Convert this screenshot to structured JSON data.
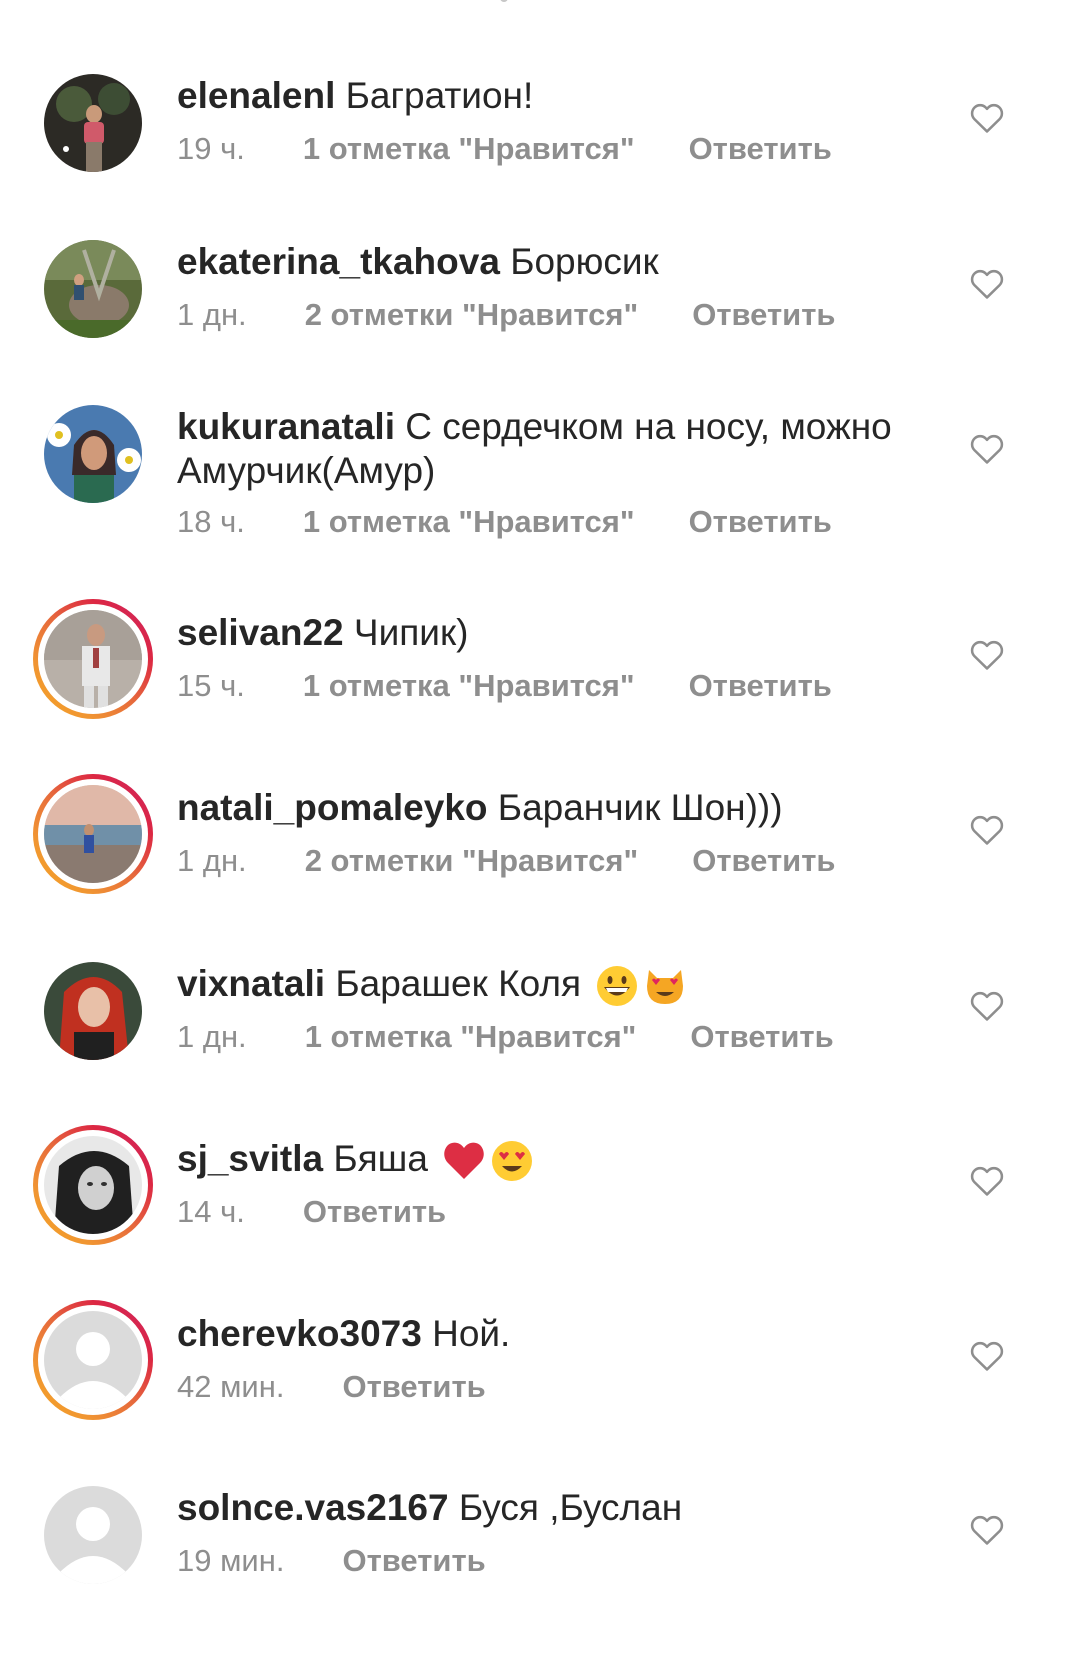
{
  "comments": [
    {
      "username": "elenalenl",
      "text": "Багратион!",
      "time": "19 ч.",
      "likes": "1 отметка \"Нравится\"",
      "reply": "Ответить",
      "story_ring": false,
      "avatar": "photo"
    },
    {
      "username": "ekaterina_tkahova",
      "text": "Борюсик",
      "time": "1 дн.",
      "likes": "2 отметки \"Нравится\"",
      "reply": "Ответить",
      "story_ring": false,
      "avatar": "photo"
    },
    {
      "username": "kukuranatali",
      "text": "С сердечком на носу, можно Амурчик(Амур)",
      "time": "18 ч.",
      "likes": "1 отметка \"Нравится\"",
      "reply": "Ответить",
      "story_ring": false,
      "avatar": "photo"
    },
    {
      "username": "selivan22",
      "text": "Чипик)",
      "time": "15 ч.",
      "likes": "1 отметка \"Нравится\"",
      "reply": "Ответить",
      "story_ring": true,
      "avatar": "photo"
    },
    {
      "username": "natali_pomaleyko",
      "text": "Баранчик Шон)))",
      "time": "1 дн.",
      "likes": "2 отметки \"Нравится\"",
      "reply": "Ответить",
      "story_ring": true,
      "avatar": "photo"
    },
    {
      "username": "vixnatali",
      "text": "Барашек Коля",
      "emojis": [
        "grinning-face-emoji",
        "heart-eyes-cat-emoji"
      ],
      "time": "1 дн.",
      "likes": "1 отметка \"Нравится\"",
      "reply": "Ответить",
      "story_ring": false,
      "avatar": "photo"
    },
    {
      "username": "sj_svitla",
      "text": "Бяша",
      "emojis": [
        "red-heart-emoji",
        "heart-eyes-emoji"
      ],
      "time": "14 ч.",
      "reply": "Ответить",
      "story_ring": true,
      "avatar": "photo"
    },
    {
      "username": "cherevko3073",
      "text": "Ной.",
      "time": "42 мин.",
      "reply": "Ответить",
      "story_ring": true,
      "avatar": "default-user-icon"
    },
    {
      "username": "solnce.vas2167",
      "text": "Буся ,Буслан",
      "time": "19 мин.",
      "reply": "Ответить",
      "story_ring": false,
      "avatar": "default-user-icon"
    }
  ],
  "icons": {
    "like": "heart-outline-icon"
  },
  "colors": {
    "username": "#262626",
    "meta": "#8e8e8e",
    "story_ring_start": "#f5a623",
    "story_ring_end": "#cc2366",
    "heart_outline": "#8e8e8e"
  }
}
